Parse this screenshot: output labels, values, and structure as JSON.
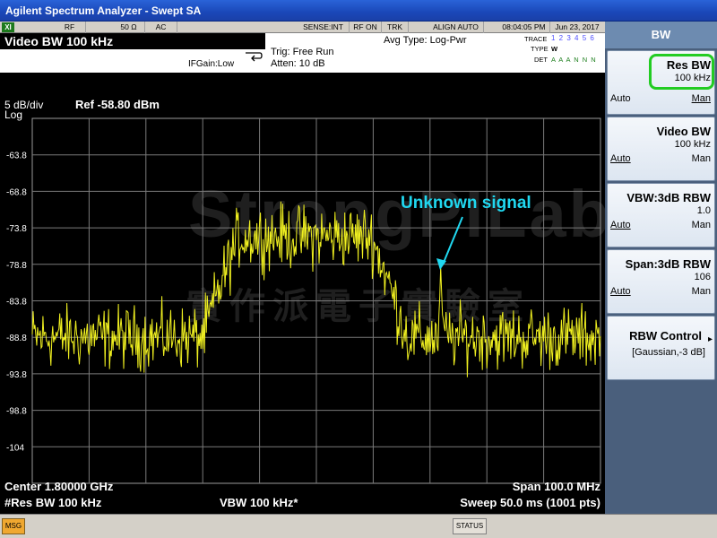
{
  "window": {
    "title": "Agilent Spectrum Analyzer - Swept SA"
  },
  "status_strip": {
    "badge": "XI",
    "rf": "RF",
    "impedance": "50 Ω",
    "coupling": "AC",
    "sense": "SENSE:INT",
    "rf_on": "RF ON",
    "trk": "TRK",
    "align": "ALIGN AUTO",
    "time": "08:04:05 PM",
    "date": "Jun 23, 2017"
  },
  "header": {
    "active_function": "Video BW 100 kHz",
    "avg_type": "Avg Type: Log-Pwr",
    "trig": "Trig: Free Run",
    "atten": "Atten: 10 dB",
    "ifgain": "IFGain:Low",
    "trace_label": "TRACE",
    "trace_values": "1 2 3 4 5 6",
    "type_label": "TYPE",
    "type_values": "W",
    "det_label": "DET",
    "det_values": "A A A N N N"
  },
  "plot": {
    "scale": "5 dB/div",
    "scale_type": "Log",
    "ref": "Ref -58.80 dBm",
    "annotation": "Unknown signal",
    "y_ticks": [
      "-63.8",
      "-68.8",
      "-73.8",
      "-78.8",
      "-83.8",
      "-88.8",
      "-93.8",
      "-98.8",
      "-104"
    ],
    "center": "Center 1.80000 GHz",
    "span": "Span 100.0 MHz",
    "res_bw": "#Res BW 100 kHz",
    "vbw": "VBW 100 kHz*",
    "sweep": "Sweep  50.0 ms (1001 pts)",
    "watermark_en": "StrongPILab",
    "watermark_zh": "實作派電子實驗室",
    "trace_color": "#f0f020",
    "annotation_color": "#20d8f0"
  },
  "softkeys": {
    "menu_title": "BW",
    "items": [
      {
        "label": "Res BW",
        "value": "100 kHz",
        "auto": "Auto",
        "man": "Man"
      },
      {
        "label": "Video BW",
        "value": "100 kHz",
        "auto": "Auto",
        "man": "Man"
      },
      {
        "label": "VBW:3dB RBW",
        "value": "1.0",
        "auto": "Auto",
        "man": "Man"
      },
      {
        "label": "Span:3dB RBW",
        "value": "106",
        "auto": "Auto",
        "man": "Man"
      },
      {
        "label": "RBW Control",
        "value": "[Gaussian,-3 dB]",
        "arrow": "▸"
      }
    ],
    "highlight_color": "#22cc22"
  },
  "bottom": {
    "msg": "MSG",
    "status": "STATUS"
  }
}
